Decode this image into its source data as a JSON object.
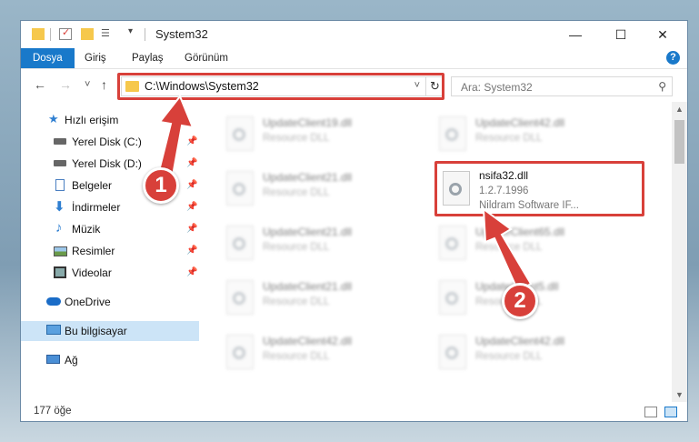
{
  "window": {
    "title": "System32",
    "controls": {
      "minimize": "—",
      "maximize": "☐",
      "close": "✕"
    }
  },
  "ribbon": {
    "tabs": [
      "Dosya",
      "Giriş",
      "Paylaş",
      "Görünüm"
    ],
    "active_tab": "Dosya",
    "help": "?"
  },
  "nav": {
    "back": "←",
    "forward": "→",
    "recent": "˅",
    "up": "↑",
    "address": "C:\\Windows\\System32",
    "address_chevron": "˅",
    "refresh": "↻",
    "search_placeholder": "Ara: System32"
  },
  "sidebar": {
    "items": [
      {
        "label": "Hızlı erişim",
        "icon": "star-icon",
        "pinned": false
      },
      {
        "label": "Yerel Disk (C:)",
        "icon": "drive-icon",
        "pinned": true
      },
      {
        "label": "Yerel Disk (D:)",
        "icon": "drive-icon",
        "pinned": true
      },
      {
        "label": "Belgeler",
        "icon": "document-icon",
        "pinned": true
      },
      {
        "label": "İndirmeler",
        "icon": "download-icon",
        "pinned": true
      },
      {
        "label": "Müzik",
        "icon": "music-icon",
        "pinned": true
      },
      {
        "label": "Resimler",
        "icon": "picture-icon",
        "pinned": true
      },
      {
        "label": "Videolar",
        "icon": "video-icon",
        "pinned": true
      },
      {
        "label": "OneDrive",
        "icon": "cloud-icon",
        "pinned": false
      },
      {
        "label": "Bu bilgisayar",
        "icon": "computer-icon",
        "pinned": false,
        "selected": true
      },
      {
        "label": "Ağ",
        "icon": "network-icon",
        "pinned": false
      }
    ],
    "pin_glyph": "📌"
  },
  "files": {
    "left_column": [
      {
        "name": "UpdateClient19.dll",
        "sub": "Resource DLL"
      },
      {
        "name": "UpdateClient21.dll",
        "sub": "Resource DLL"
      },
      {
        "name": "UpdateClient21.dll",
        "sub": "Resource DLL"
      },
      {
        "name": "UpdateClient21.dll",
        "sub": "Resource DLL"
      },
      {
        "name": "UpdateClient42.dll",
        "sub": "Resource DLL"
      }
    ],
    "right_column": [
      {
        "name": "UpdateClient42.dll",
        "sub": "Resource DLL"
      },
      {
        "name": "UpdateClient65.dll",
        "sub": "Resource DLL"
      },
      {
        "name": "UpdateClient5.dll",
        "sub": "Resource DLL"
      },
      {
        "name": "UpdateClient42.dll",
        "sub": "Resource DLL"
      }
    ],
    "highlighted": {
      "name": "nsifa32.dll",
      "version": "1.2.7.1996",
      "company": "Nildram Software IF..."
    }
  },
  "status": {
    "count": "177 öğe"
  },
  "annotations": {
    "step1": "1",
    "step2": "2",
    "color": "#d8403a"
  }
}
